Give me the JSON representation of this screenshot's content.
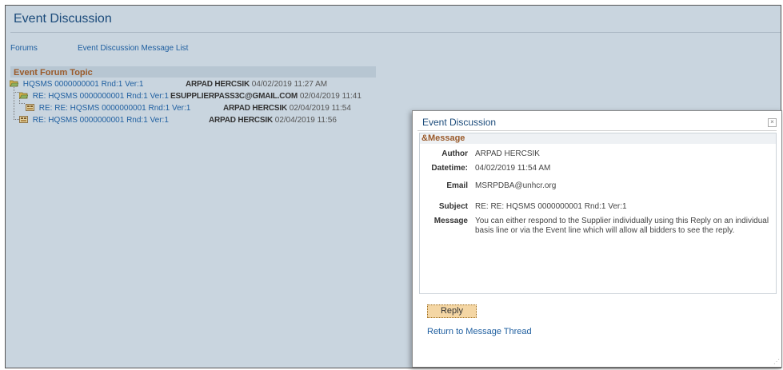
{
  "page": {
    "title": "Event Discussion",
    "nav": {
      "forums": "Forums",
      "message_list": "Event Discussion Message List"
    }
  },
  "forum": {
    "section_title": "Event Forum Topic",
    "threads": [
      {
        "subject": "HQSMS 0000000001 Rnd:1 Ver:1",
        "author": "ARPAD HERCSIK",
        "datetime": "04/02/2019 11:27 AM"
      },
      {
        "subject": "RE: HQSMS 0000000001 Rnd:1 Ver:1",
        "author": "ESUPPLIERPASS3C@GMAIL.COM",
        "datetime": "02/04/2019 11:41"
      },
      {
        "subject": "RE: RE: HQSMS 0000000001 Rnd:1 Ver:1",
        "author": "ARPAD HERCSIK",
        "datetime": "02/04/2019 11:54"
      },
      {
        "subject": "RE: HQSMS 0000000001 Rnd:1 Ver:1",
        "author": "ARPAD HERCSIK",
        "datetime": "02/04/2019 11:56"
      }
    ]
  },
  "modal": {
    "title": "Event Discussion",
    "close_glyph": "×",
    "group_title": "&Message",
    "fields": {
      "author_label": "Author",
      "author": "ARPAD HERCSIK",
      "datetime_label": "Datetime:",
      "datetime": "04/02/2019 11:54 AM",
      "email_label": "Email",
      "email": "MSRPDBA@unhcr.org",
      "subject_label": "Subject",
      "subject": "RE: RE: HQSMS 0000000001 Rnd:1 Ver:1",
      "message_label": "Message",
      "message": "You can either respond to the Supplier individually using this Reply on an individual basis line or via the Event line which will allow all bidders to see the reply."
    },
    "reply_label": "Reply",
    "return_label": "Return to Message Thread",
    "grip_glyph": "⋰"
  },
  "colors": {
    "background": "#c9d5df",
    "link": "#1f5fa0",
    "section_title": "#9a5a2a"
  },
  "icons": {
    "thread_root": "folder-open-icon",
    "thread_leaf": "message-icon"
  }
}
